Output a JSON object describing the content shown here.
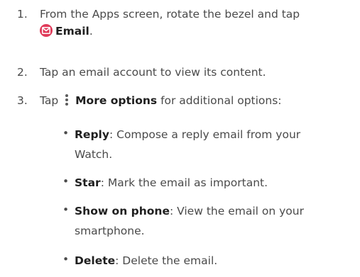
{
  "steps": [
    {
      "number": "1.",
      "text_before": "From the Apps screen, rotate the bezel and tap",
      "icon": "email-icon",
      "bold": "Email",
      "text_after": "."
    },
    {
      "number": "2.",
      "text": "Tap an email account to view its content."
    },
    {
      "number": "3.",
      "text_before": "Tap",
      "icon": "more-options-icon",
      "bold": "More options",
      "text_after": " for additional options:"
    }
  ],
  "options": [
    {
      "bold": "Reply",
      "text": ": Compose a reply email from your Watch."
    },
    {
      "bold": "Star",
      "text": ": Mark the email as important."
    },
    {
      "bold": "Show on phone",
      "text": ": View the email on your smartphone."
    },
    {
      "bold": "Delete",
      "text": ": Delete the email."
    }
  ],
  "bullet_char": "•",
  "colors": {
    "text": "#4a4a4a",
    "bold_text": "#1f1f1f",
    "email_icon": "#e03b5a"
  }
}
